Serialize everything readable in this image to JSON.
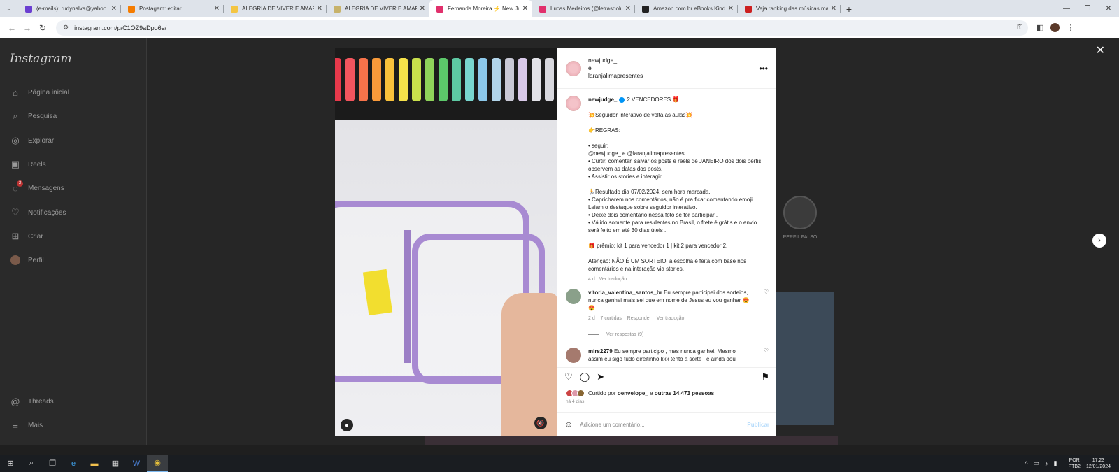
{
  "tabs": [
    {
      "title": "(e-mails): rudynalva@yahoo.com",
      "color": "#6b3fd1",
      "active": false
    },
    {
      "title": "Postagem: editar",
      "color": "#f57c00",
      "active": false
    },
    {
      "title": "ALEGRIA DE VIVER E AMAR O Q",
      "color": "#f4c542",
      "active": false
    },
    {
      "title": "ALEGRIA DE VIVER E AMAR O Q",
      "color": "#c7b26a",
      "active": false
    },
    {
      "title": "Fernanda Moreira ⚡ New Judg",
      "color": "#e1306c",
      "active": true
    },
    {
      "title": "Lucas Medeiros (@letrasdoluca",
      "color": "#e1306c",
      "active": false
    },
    {
      "title": "Amazon.com.br eBooks Kindle:",
      "color": "#222222",
      "active": false
    },
    {
      "title": "Veja ranking das músicas mais t",
      "color": "#cc1f1f",
      "active": false
    }
  ],
  "address": {
    "url": "instagram.com/p/C1OZ9aDpo6e/"
  },
  "sidebar": {
    "logo": "Instagram",
    "items": [
      {
        "label": "Página inicial",
        "icon": "home-icon",
        "glyph": "⌂"
      },
      {
        "label": "Pesquisa",
        "icon": "search-icon",
        "glyph": "⌕"
      },
      {
        "label": "Explorar",
        "icon": "compass-icon",
        "glyph": "◎"
      },
      {
        "label": "Reels",
        "icon": "reels-icon",
        "glyph": "▣"
      },
      {
        "label": "Mensagens",
        "icon": "messenger-icon",
        "glyph": "◌",
        "badge": "2"
      },
      {
        "label": "Notificações",
        "icon": "heart-icon",
        "glyph": "♡"
      },
      {
        "label": "Criar",
        "icon": "plus-square-icon",
        "glyph": "⊞"
      },
      {
        "label": "Perfil",
        "icon": "avatar",
        "glyph": ""
      }
    ],
    "bottom": [
      {
        "label": "Threads",
        "icon": "threads-icon",
        "glyph": "@"
      },
      {
        "label": "Mais",
        "icon": "menu-icon",
        "glyph": "≡"
      }
    ]
  },
  "background": {
    "suggestion_label": "PERFIL FALSO"
  },
  "post": {
    "header": {
      "user1": "newjudge_",
      "joiner": "e",
      "user2": "laranjalimapresentes"
    },
    "caption": {
      "username": "newjudge_",
      "title": "2 VENCEDORES 🎁",
      "lines": [
        "",
        "💥Seguidor Interativo de volta às aulas💥",
        "",
        "👉REGRAS:",
        "",
        "• seguir:",
        "@newjudge_ e @laranjalimapresentes",
        "• Curtir, comentar, salvar os posts e reels de JANEIRO dos dois perfis, observem as datas dos posts.",
        "• Assistir os stories e interagir.",
        "",
        "🏃Resultado dia 07/02/2024, sem hora marcada.",
        "• Capricharem nos comentários, não é pra ficar comentando emoji. Leiam o destaque sobre seguidor interativo.",
        "• Deixe dois comentário nessa foto se for participar .",
        "• Válido somente para residentes no Brasil, o frete é grátis e o envio será feito em até 30 dias úteis .",
        "",
        "🎁 prêmio: kit 1 para vencedor 1 | kit 2 para vencedor 2.",
        "",
        "Atenção: NÃO É UM SORTEIO, a escolha é feita com base nos comentários e na interação via stories."
      ],
      "time": "4 d",
      "translate": "Ver tradução"
    },
    "comments": [
      {
        "username": "vitoria_valentina_santos_br",
        "text": "Eu sempre participei dos sorteios, nunca ganhei mais sei que em nome de Jesus eu vou ganhar 😍😍",
        "time": "2 d",
        "likes": "7 curtidas",
        "reply": "Responder",
        "translate": "Ver tradução",
        "view_replies": "Ver respostas (9)",
        "avatar_color": "#8aa08a"
      },
      {
        "username": "mirs2279",
        "text": "Eu sempre participo , mas nunca ganhei. Mesmo assim eu sigo tudo direitinho kkk tento a sorte , e ainda dou",
        "avatar_color": "#a57a6e"
      }
    ],
    "liked_by": {
      "prefix": "Curtido por",
      "user": "oenvelope_",
      "joiner": "e",
      "others": "outras 14.473 pessoas"
    },
    "ago": "há 4 dias",
    "add_comment": {
      "placeholder": "Adicione um comentário...",
      "publish": "Publicar"
    }
  },
  "taskbar": {
    "lang": "POR",
    "layout": "PTB2",
    "time": "17:23",
    "date": "12/01/2024"
  }
}
